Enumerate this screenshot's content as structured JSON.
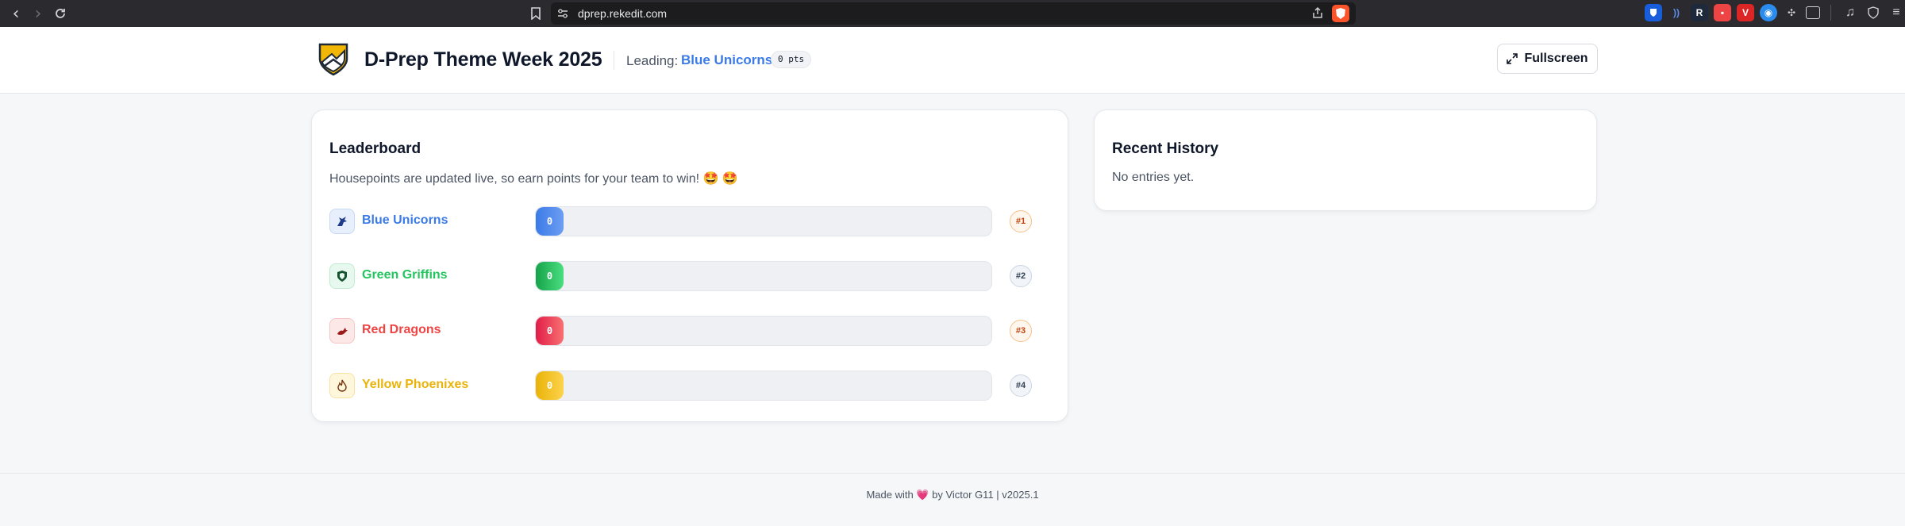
{
  "browser": {
    "url": "dprep.rekedit.com",
    "brave_badge": "1"
  },
  "header": {
    "title": "D-Prep Theme Week 2025",
    "leading_label": "Leading:",
    "leading_team": "Blue Unicorns",
    "leading_points": "0 pts",
    "fullscreen_label": "Fullscreen"
  },
  "leaderboard": {
    "title": "Leaderboard",
    "subtitle": "Housepoints are updated live, so earn points for your team to win! 🤩 🤩",
    "teams": [
      {
        "name": "Blue Unicorns",
        "points": "0",
        "rank": "#1",
        "color": "#3b7be8",
        "icon": "unicorn-icon",
        "fill_fraction": 0
      },
      {
        "name": "Green Griffins",
        "points": "0",
        "rank": "#2",
        "color": "#22c55e",
        "icon": "shield-icon",
        "fill_fraction": 0
      },
      {
        "name": "Red Dragons",
        "points": "0",
        "rank": "#3",
        "color": "#ef4444",
        "icon": "dragon-icon",
        "fill_fraction": 0
      },
      {
        "name": "Yellow Phoenixes",
        "points": "0",
        "rank": "#4",
        "color": "#eab308",
        "icon": "flame-icon",
        "fill_fraction": 0
      }
    ]
  },
  "history": {
    "title": "Recent History",
    "empty": "No entries yet."
  },
  "footer": {
    "made_with": "Made with",
    "heart": "💗",
    "credit": "by Victor G11 | v2025.1"
  }
}
